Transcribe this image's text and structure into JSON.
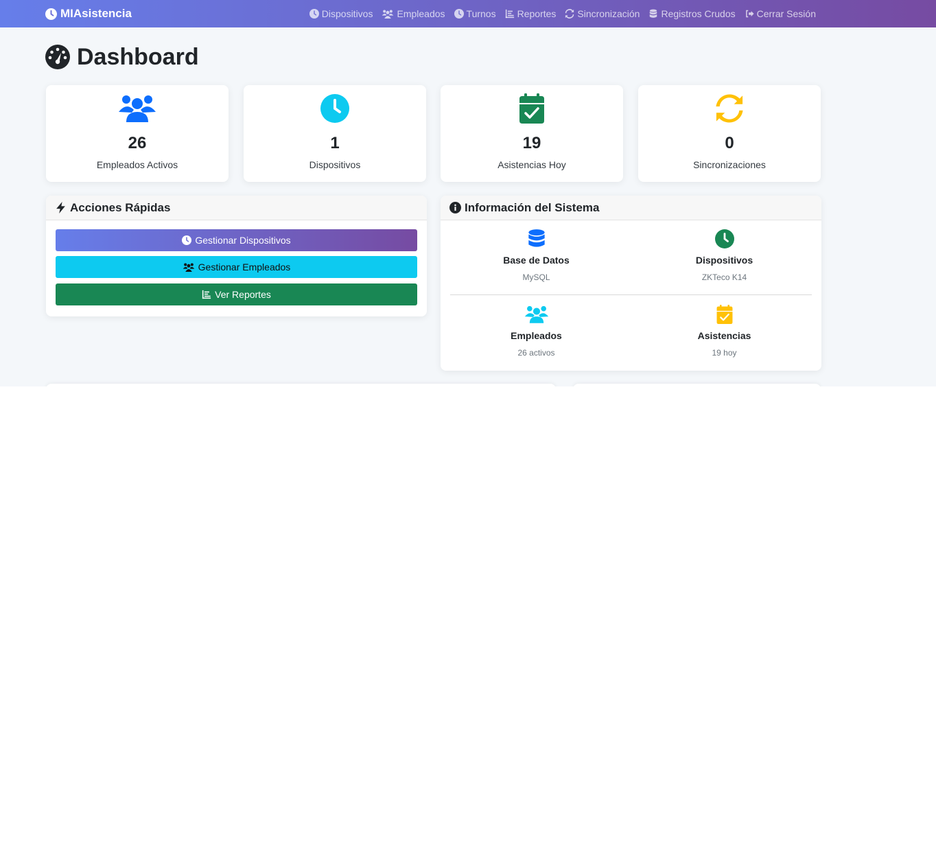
{
  "navbar": {
    "brand": "MIAsistencia",
    "links": [
      {
        "label": "Dispositivos",
        "icon": "clock-icon"
      },
      {
        "label": "Empleados",
        "icon": "users-icon"
      },
      {
        "label": "Turnos",
        "icon": "clock-icon"
      },
      {
        "label": "Reportes",
        "icon": "chart-icon"
      },
      {
        "label": "Sincronización",
        "icon": "sync-icon"
      },
      {
        "label": "Registros Crudos",
        "icon": "database-icon"
      },
      {
        "label": "Cerrar Sesión",
        "icon": "logout-icon"
      }
    ]
  },
  "page": {
    "title": "Dashboard",
    "icon": "tachometer-icon"
  },
  "stats": [
    {
      "value": "26",
      "label": "Empleados Activos",
      "icon": "users-icon",
      "color": "#0d6efd"
    },
    {
      "value": "1",
      "label": "Dispositivos",
      "icon": "clock-icon",
      "color": "#0dcaf0"
    },
    {
      "value": "19",
      "label": "Asistencias Hoy",
      "icon": "calendar-check-icon",
      "color": "#198754"
    },
    {
      "value": "0",
      "label": "Sincronizaciones",
      "icon": "sync-icon",
      "color": "#ffc107"
    }
  ],
  "quick_actions": {
    "title": "Acciones Rápidas",
    "icon": "bolt-icon",
    "buttons": [
      {
        "label": "Gestionar Dispositivos",
        "icon": "clock-icon"
      },
      {
        "label": "Gestionar Empleados",
        "icon": "users-icon"
      },
      {
        "label": "Ver Reportes",
        "icon": "chart-icon"
      }
    ]
  },
  "system_info": {
    "title": "Información del Sistema",
    "icon": "info-circle-icon",
    "items": [
      {
        "title": "Base de Datos",
        "value": "MySQL",
        "icon": "database-icon",
        "color": "#0d6efd"
      },
      {
        "title": "Dispositivos",
        "value": "ZKTeco K14",
        "icon": "clock-icon",
        "color": "#198754"
      },
      {
        "title": "Empleados",
        "value": "26 activos",
        "icon": "users-icon",
        "color": "#0dcaf0"
      },
      {
        "title": "Asistencias",
        "value": "19 hoy",
        "icon": "calendar-check-icon",
        "color": "#ffc107"
      }
    ]
  },
  "colors": {
    "nav_gradient_start": "#667eea",
    "nav_gradient_end": "#764ba2",
    "btn_info": "#0dcaf0",
    "btn_success": "#198754"
  }
}
